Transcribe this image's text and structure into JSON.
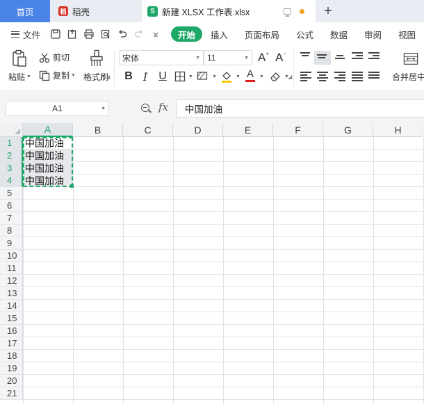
{
  "tabs": {
    "home": "首页",
    "daoke": "稻壳",
    "doc": "新建 XLSX 工作表.xlsx",
    "add": "+"
  },
  "menu": {
    "file": "文件",
    "items": [
      "开始",
      "插入",
      "页面布局",
      "公式",
      "数据",
      "审阅",
      "视图"
    ],
    "active_index": 0
  },
  "ribbon": {
    "paste": "粘贴",
    "cut": "剪切",
    "copy": "复制",
    "format_painter": "格式刷",
    "font_name": "宋体",
    "font_size": "11",
    "merge_center": "合并居中",
    "bold": "B",
    "italic": "I",
    "underline": "U",
    "font_color_letter": "A"
  },
  "formula": {
    "cell_ref": "A1",
    "fx": "fx",
    "value": "中国加油"
  },
  "sheet": {
    "columns": [
      "A",
      "B",
      "C",
      "D",
      "E",
      "F",
      "G",
      "H"
    ],
    "selected_column": "A",
    "rows": [
      "1",
      "2",
      "3",
      "4",
      "5",
      "6",
      "7",
      "8",
      "9",
      "10",
      "11",
      "12",
      "13",
      "14",
      "15",
      "16",
      "17",
      "18",
      "19",
      "20",
      "21"
    ],
    "selected_rows": [
      "1",
      "2",
      "3",
      "4"
    ],
    "cells": [
      {
        "ref": "A1",
        "value": "中国加油"
      },
      {
        "ref": "A2",
        "value": "中国加油"
      },
      {
        "ref": "A3",
        "value": "中国加油"
      },
      {
        "ref": "A4",
        "value": "中国加油"
      }
    ]
  },
  "colors": {
    "accent": "#1da868",
    "home_tab": "#4a84e8",
    "daoke": "#d9342b"
  }
}
